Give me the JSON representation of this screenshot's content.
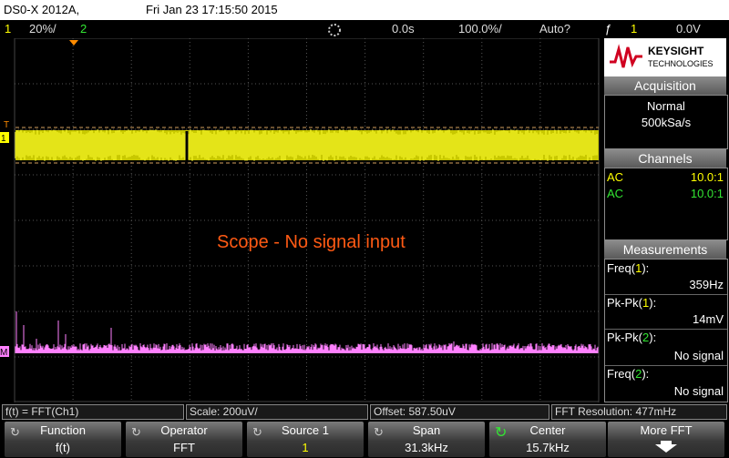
{
  "topbar": {
    "model": "DS0-X 2012A,",
    "datetime": "Fri Jan 23 17:15:50 2015"
  },
  "status": {
    "ch1_num": "1",
    "ch1_scale": "20%/",
    "ch2_num": "2",
    "time_offset": "0.0s",
    "time_scale": "100.0%/",
    "trigger_mode": "Auto?",
    "trigger_ch": "1",
    "trigger_level": "0.0V"
  },
  "screen": {
    "annotation": "Scope - No signal input",
    "ch1_marker": "1",
    "trig_marker": "T",
    "math_marker": "M"
  },
  "panel": {
    "brand_top": "KEYSIGHT",
    "brand_bottom": "TECHNOLOGIES",
    "acquisition": {
      "title": "Acquisition",
      "mode": "Normal",
      "rate": "500kSa/s"
    },
    "channels": {
      "title": "Channels",
      "rows": [
        {
          "coupling": "AC",
          "probe": "10.0:1"
        },
        {
          "coupling": "AC",
          "probe": "10.0:1"
        }
      ]
    },
    "measurements": {
      "title": "Measurements",
      "items": [
        {
          "name": "Freq",
          "src": "1",
          "value": "359Hz"
        },
        {
          "name": "Pk-Pk",
          "src": "1",
          "value": "14mV"
        },
        {
          "name": "Pk-Pk",
          "src": "2",
          "value": "No signal"
        },
        {
          "name": "Freq",
          "src": "2",
          "value": "No signal"
        }
      ]
    }
  },
  "strip": {
    "function": "f(t) = FFT(Ch1)",
    "scale": "Scale: 200uV/",
    "offset": "Offset: 587.50uV",
    "resolution": "FFT Resolution: 477mHz"
  },
  "softkeys": [
    {
      "label": "Function",
      "value": "f(t)"
    },
    {
      "label": "Operator",
      "value": "FFT"
    },
    {
      "label": "Source 1",
      "value": "1"
    },
    {
      "label": "Span",
      "value": "31.3kHz"
    },
    {
      "label": "Center",
      "value": "15.7kHz"
    },
    {
      "label": "More FFT",
      "value": ""
    }
  ],
  "colors": {
    "ch1": "#ffff00",
    "ch2": "#33e633",
    "math": "#ff80ff",
    "annotation": "#ff5a14"
  }
}
